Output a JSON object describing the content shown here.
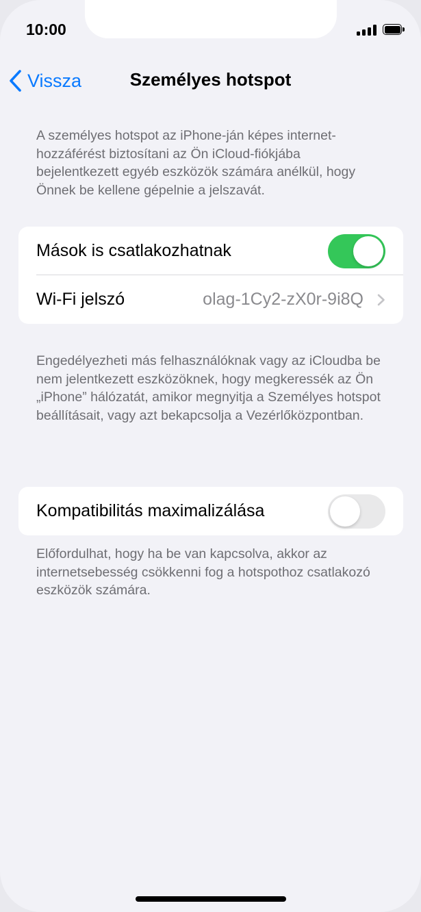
{
  "status_bar": {
    "time": "10:00",
    "signal_icon": "cellular-signal-icon",
    "battery_icon": "battery-icon"
  },
  "nav": {
    "back_label": "Vissza",
    "back_icon": "chevron-left-icon",
    "title": "Személyes hotspot"
  },
  "intro_text": "A személyes hotspot az iPhone-ján képes internet-hozzáférést biztosítani az Ön iCloud-fiókjába bejelentkezett egyéb eszközök számára anélkül, hogy Önnek be kellene gépelnie a jelszavát.",
  "group1": {
    "allow_others": {
      "label": "Mások is csatlakozhatnak",
      "state": "on"
    },
    "wifi_password": {
      "label": "Wi-Fi jelszó",
      "value": "olag-1Cy2-zX0r-9i8Q"
    }
  },
  "group1_footer": "Engedélyezheti más felhasználóknak vagy az iCloudba be nem jelentkezett eszközöknek, hogy megkeressék az Ön „iPhone” hálózatát, amikor megnyitja a Személyes hotspot beállításait, vagy azt bekapcsolja a Vezérlőközpontban.",
  "group2": {
    "maximize_compatibility": {
      "label": "Kompatibilitás maximalizálása",
      "state": "off"
    }
  },
  "group2_footer": "Előfordulhat, hogy ha be van kapcsolva, akkor az internetsebesség csökkenni fog a hotspothoz csatlakozó eszközök számára.",
  "colors": {
    "accent": "#0a7aff",
    "toggle_on": "#34c759",
    "background": "#f2f2f7",
    "secondary_text": "#6e6e73"
  }
}
